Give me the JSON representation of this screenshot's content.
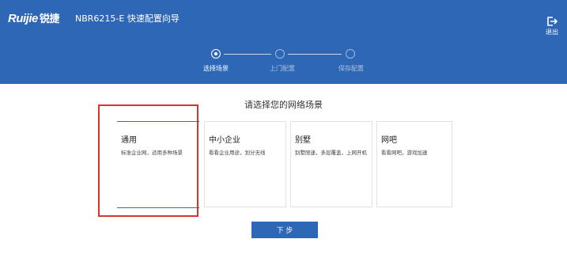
{
  "header": {
    "brand_latin": "Ruijie",
    "brand_cn": "锐捷",
    "title": "NBR6215-E  快速配置向导",
    "logout_label": "退出",
    "steps": [
      {
        "label": "选择场景",
        "active": true
      },
      {
        "label": "上门配置",
        "active": false
      },
      {
        "label": "保存配置",
        "active": false
      }
    ]
  },
  "main": {
    "prompt": "请选择您的网络场景",
    "scenarios": [
      {
        "title": "通用",
        "desc": "标准企业网，适用多种场景",
        "selected": true
      },
      {
        "title": "中小企业",
        "desc": "看看企业用途，划分无线",
        "selected": false
      },
      {
        "title": "别墅",
        "desc": "别墅限速，多层覆盖，上网开机",
        "selected": false
      },
      {
        "title": "网吧",
        "desc": "看看网吧，游戏加速",
        "selected": false
      }
    ],
    "next_label": "下 步"
  },
  "colors": {
    "header_bg": "#2d67b5",
    "highlight": "#d9342b",
    "button_bg": "#2d67b5"
  }
}
